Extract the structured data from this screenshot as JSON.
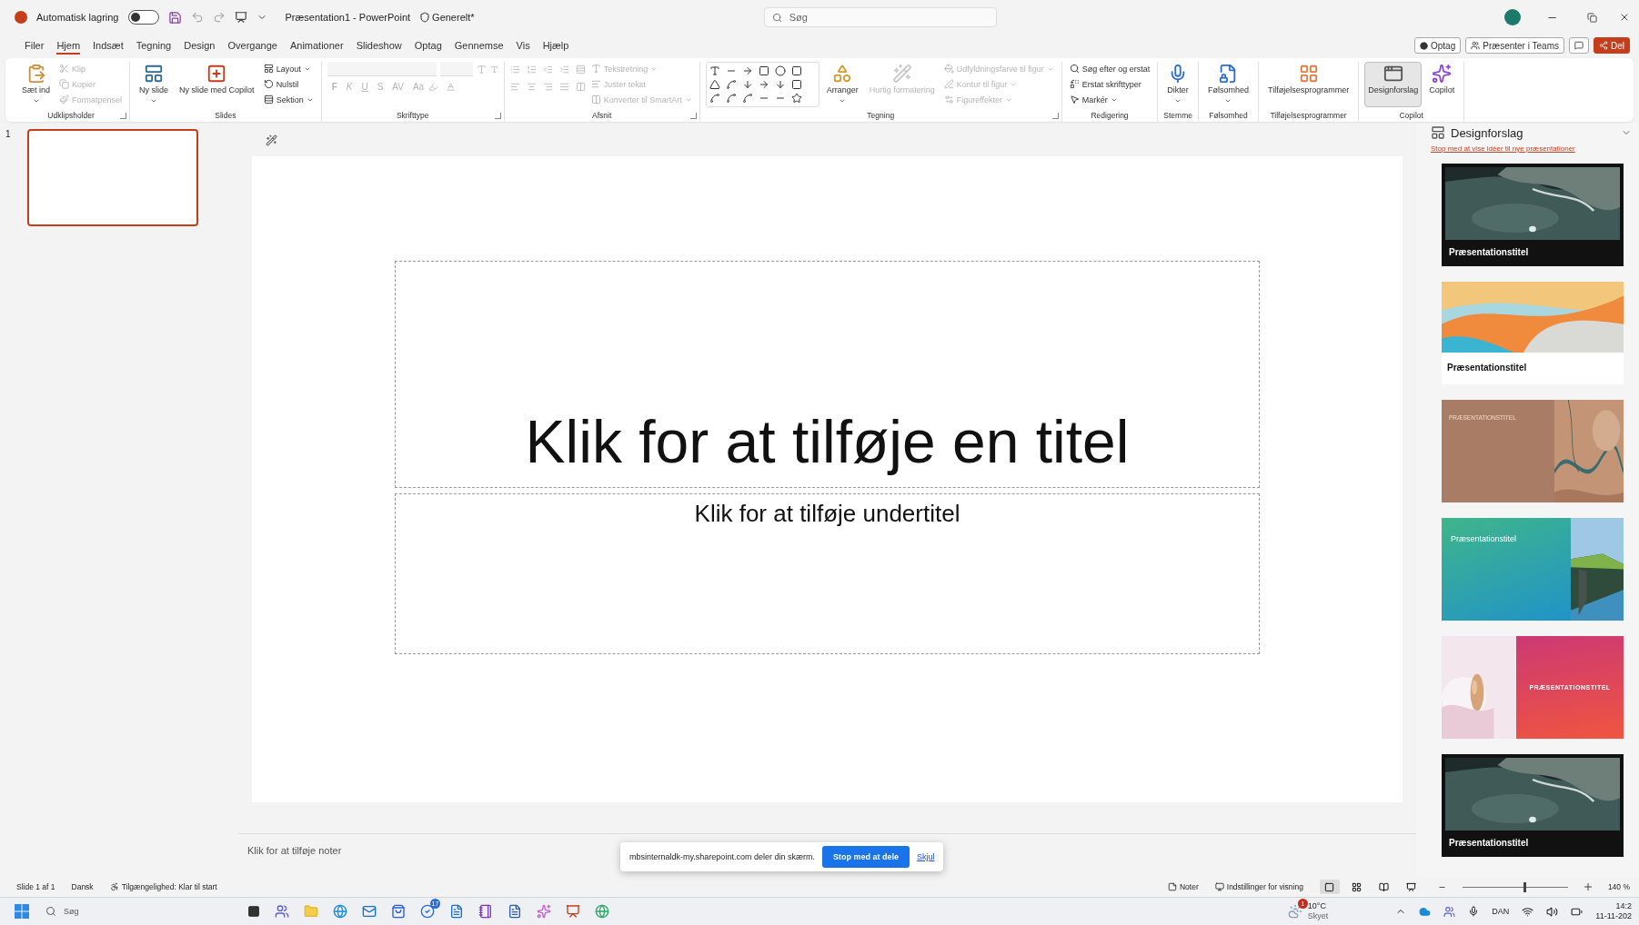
{
  "title_bar": {
    "autosave_label": "Automatisk lagring",
    "autosave_on": false,
    "document_title": "Præsentation1 - PowerPoint",
    "sensitivity": "Generelt*",
    "search_placeholder": "Søg"
  },
  "menu_tabs": [
    {
      "label": "Filer",
      "selected": false
    },
    {
      "label": "Hjem",
      "selected": true
    },
    {
      "label": "Indsæt",
      "selected": false
    },
    {
      "label": "Tegning",
      "selected": false
    },
    {
      "label": "Design",
      "selected": false
    },
    {
      "label": "Overgange",
      "selected": false
    },
    {
      "label": "Animationer",
      "selected": false
    },
    {
      "label": "Slideshow",
      "selected": false
    },
    {
      "label": "Optag",
      "selected": false
    },
    {
      "label": "Gennemse",
      "selected": false
    },
    {
      "label": "Vis",
      "selected": false
    },
    {
      "label": "Hjælp",
      "selected": false
    }
  ],
  "header_buttons": [
    {
      "kind": "record",
      "label": "Optag"
    },
    {
      "kind": "teams",
      "label": "Præsenter i Teams"
    },
    {
      "kind": "comments"
    },
    {
      "kind": "share",
      "label": "Del"
    }
  ],
  "ribbon": {
    "groups": [
      {
        "label": "Udklipsholder",
        "kind": "standard",
        "launcher": true,
        "items": [
          {
            "kind": "large",
            "label": "Sæt ind",
            "disabled": false,
            "dropdown": true
          },
          {
            "kind": "small",
            "label": "Klip",
            "disabled": true
          },
          {
            "kind": "small",
            "label": "Kopier",
            "disabled": true
          },
          {
            "kind": "small",
            "label": "Formatpensel",
            "disabled": true
          }
        ]
      },
      {
        "label": "Slides",
        "kind": "standard",
        "items": [
          {
            "kind": "large",
            "label": "Ny slide",
            "disabled": false,
            "dropdown": true
          },
          {
            "kind": "large",
            "label": "Ny slide med Copilot",
            "disabled": false
          },
          {
            "kind": "small",
            "label": "Layout",
            "disabled": false,
            "dropdown": true
          },
          {
            "kind": "small",
            "label": "Nulstil",
            "disabled": false
          },
          {
            "kind": "small",
            "label": "Sektion",
            "disabled": false,
            "dropdown": true
          }
        ]
      },
      {
        "label": "Skrifttype",
        "kind": "font",
        "launcher": true,
        "items": [
          {
            "kind": "glyph",
            "label": "F",
            "disabled": true
          },
          {
            "kind": "glyph",
            "label": "K",
            "disabled": true
          },
          {
            "kind": "glyph",
            "label": "U",
            "disabled": true
          },
          {
            "kind": "glyph",
            "label": "S",
            "disabled": true
          },
          {
            "kind": "glyph",
            "label": "AV",
            "disabled": true
          },
          {
            "kind": "glyph",
            "label": "Aa",
            "disabled": true
          }
        ]
      },
      {
        "label": "Afsnit",
        "kind": "paragraph",
        "launcher": true,
        "items": [
          {
            "kind": "small",
            "label": "Tekstretning",
            "disabled": true,
            "dropdown": true
          },
          {
            "kind": "small",
            "label": "Juster tekst",
            "disabled": true
          },
          {
            "kind": "small",
            "label": "Konverter til SmartArt",
            "disabled": true,
            "dropdown": true
          }
        ]
      },
      {
        "label": "Tegning",
        "kind": "shapes",
        "launcher": true,
        "items": [
          {
            "kind": "large",
            "label": "Arranger",
            "disabled": false,
            "dropdown": true
          },
          {
            "kind": "large",
            "label": "Hurtig formatering",
            "disabled": true
          },
          {
            "kind": "small",
            "label": "Udfyldningsfarve til figur",
            "disabled": true,
            "dropdown": true
          },
          {
            "kind": "small",
            "label": "Kontur til figur",
            "disabled": true,
            "dropdown": true
          },
          {
            "kind": "small",
            "label": "Figureffekter",
            "disabled": true,
            "dropdown": true
          }
        ]
      },
      {
        "label": "Redigering",
        "kind": "standard",
        "items": [
          {
            "kind": "small",
            "label": "Søg efter og erstat",
            "disabled": false
          },
          {
            "kind": "small",
            "label": "Erstat skrifttyper",
            "disabled": false
          },
          {
            "kind": "small",
            "label": "Markér",
            "disabled": false,
            "dropdown": true
          }
        ]
      },
      {
        "label": "Stemme",
        "kind": "standard",
        "items": [
          {
            "kind": "large",
            "label": "Dikter",
            "disabled": false,
            "dropdown": true
          }
        ]
      },
      {
        "label": "Følsomhed",
        "kind": "standard",
        "items": [
          {
            "kind": "large",
            "label": "Følsomhed",
            "disabled": false,
            "dropdown": true
          }
        ]
      },
      {
        "label": "Tilføjelsesprogrammer",
        "kind": "standard",
        "items": [
          {
            "kind": "large",
            "label": "Tilføjelsesprogrammer",
            "disabled": false
          }
        ]
      },
      {
        "label": "Copilot",
        "kind": "standard",
        "items": [
          {
            "kind": "large",
            "label": "Designforslag",
            "disabled": false,
            "pressed": true
          },
          {
            "kind": "large",
            "label": "Copilot",
            "disabled": false,
            "pressed": false
          }
        ]
      }
    ]
  },
  "thumbnails": [
    {
      "number": "1",
      "selected": true
    }
  ],
  "slide": {
    "title_placeholder": "Klik for at tilføje en titel",
    "subtitle_placeholder": "Klik for at tilføje undertitel"
  },
  "notes_placeholder": "Klik for at tilføje noter",
  "design_pane": {
    "title": "Designforslag",
    "link": "Stop med at vise idéer til nye præsentationer",
    "designs": [
      {
        "kind": "dark-band",
        "title": "Præsentationstitel"
      },
      {
        "kind": "light-band",
        "title": "Præsentationstitel"
      },
      {
        "kind": "left-panel",
        "title": "PRÆSENTATIONSTITEL"
      },
      {
        "kind": "left-gradient",
        "title": "Præsentationstitel"
      },
      {
        "kind": "right-panel",
        "title": "PRÆSENTATIONSTITEL"
      },
      {
        "kind": "dark-band",
        "title": "Præsentationstitel"
      }
    ]
  },
  "share_banner": {
    "message": "mbsinternaldk-my.sharepoint.com deler din skærm.",
    "stop_button": "Stop med at dele",
    "hide_link": "Skjul"
  },
  "status_bar": {
    "slide_info": "Slide 1 af 1",
    "language": "Dansk",
    "accessibility": "Tilgængelighed: Klar til start",
    "notes": "Noter",
    "view_settings": "Indstillinger for visning",
    "view_buttons": [
      {
        "selected": true
      },
      {
        "selected": false
      },
      {
        "selected": false
      },
      {
        "selected": false
      }
    ],
    "zoom_slider": {
      "level": 0.6
    },
    "zoom": "140 %"
  },
  "taskbar": {
    "search_placeholder": "Søg",
    "todo_badge": "17",
    "weather_badge": "1",
    "temperature": "10°C",
    "weather": "Skyet",
    "language": "DAN",
    "time": "14:2",
    "date": "11-11-202"
  }
}
